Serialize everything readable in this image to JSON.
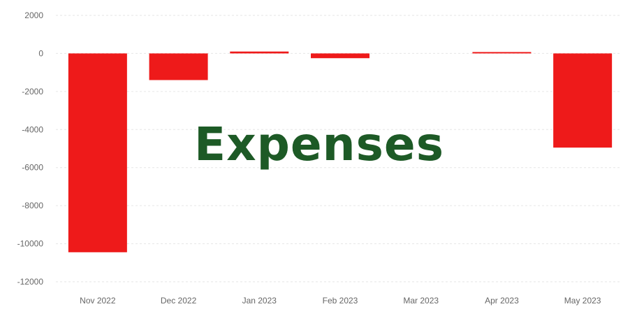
{
  "overlay_title": "Expenses",
  "chart_data": {
    "type": "bar",
    "categories": [
      "Nov 2022",
      "Dec 2022",
      "Jan 2023",
      "Feb 2023",
      "Mar 2023",
      "Apr 2023",
      "May 2023"
    ],
    "values": [
      -10450,
      -1400,
      100,
      -250,
      0,
      50,
      -4950
    ],
    "yticks": [
      2000,
      0,
      -2000,
      -4000,
      -6000,
      -8000,
      -10000,
      -12000
    ],
    "ylim": [
      -12000,
      2000
    ],
    "grid": true,
    "bar_color": "#ee1a1a",
    "title_color": "#1d5a26"
  }
}
